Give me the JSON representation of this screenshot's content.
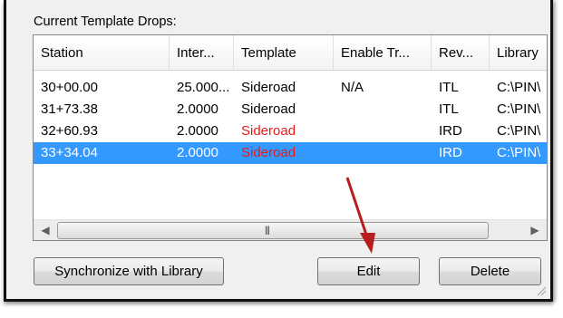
{
  "group_label": "Current Template Drops:",
  "columns": [
    "Station",
    "Inter...",
    "Template",
    "Enable Tr...",
    "Rev...",
    "Library"
  ],
  "rows": [
    {
      "station": "30+00.00",
      "interval": "25.000...",
      "template": "Sideroad",
      "enable": "N/A",
      "rev": "ITL",
      "library": "C:\\PIN\\",
      "selected": false,
      "template_color": "#000000"
    },
    {
      "station": "31+73.38",
      "interval": "2.0000",
      "template": "Sideroad",
      "enable": "",
      "rev": "ITL",
      "library": "C:\\PIN\\",
      "selected": false,
      "template_color": "#000000"
    },
    {
      "station": "32+60.93",
      "interval": "2.0000",
      "template": "Sideroad",
      "enable": "",
      "rev": "IRD",
      "library": "C:\\PIN\\",
      "selected": false,
      "template_color": "#e81a1a"
    },
    {
      "station": "33+34.04",
      "interval": "2.0000",
      "template": "Sideroad",
      "enable": "",
      "rev": "IRD",
      "library": "C:\\PIN\\",
      "selected": true,
      "template_color": "#e81a1a"
    }
  ],
  "scrollbar": {
    "left_icon": "scroll-left-arrow-icon",
    "right_icon": "scroll-right-arrow-icon",
    "grip_icon": "grip-icon"
  },
  "buttons": {
    "sync": "Synchronize with Library",
    "edit": "Edit",
    "delete": "Delete"
  },
  "annotation": {
    "icon": "red-arrow-annotation",
    "color": "#b81c1c"
  },
  "colors": {
    "selection": "#3399ff",
    "red_template": "#e81a1a"
  }
}
